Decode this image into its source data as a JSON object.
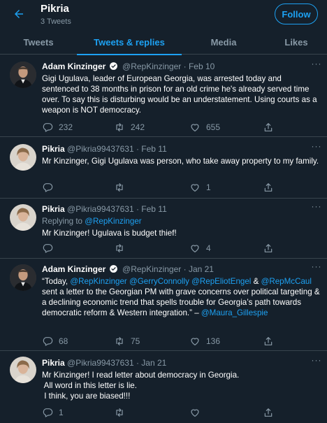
{
  "header": {
    "title": "Pikria",
    "subtitle": "3 Tweets",
    "follow_label": "Follow"
  },
  "tabs": [
    {
      "label": "Tweets",
      "active": false
    },
    {
      "label": "Tweets & replies",
      "active": true
    },
    {
      "label": "Media",
      "active": false
    },
    {
      "label": "Likes",
      "active": false
    }
  ],
  "colors": {
    "background": "#15202b",
    "accent": "#1da1f2",
    "muted": "#8899a6",
    "divider": "#38444d"
  },
  "tweets": [
    {
      "name": "Adam Kinzinger",
      "verified": true,
      "handle": "@RepKinzinger",
      "date": "· Feb 10",
      "text": "Gigi Ugulava, leader of European Georgia, was arrested today and sentenced to 38 months in prison for an old crime he's already served time over. To say this is disturbing would be an understatement. Using courts as a weapon is NOT democracy.",
      "replies": "232",
      "retweets": "242",
      "likes": "655"
    },
    {
      "name": "Pikria",
      "verified": false,
      "handle": "@Pikria99437631",
      "date": "· Feb 11",
      "text": "Mr Kinzinger, Gigi Ugulava was person, who take away property to my family.",
      "replies": "",
      "retweets": "",
      "likes": "1"
    },
    {
      "name": "Pikria",
      "verified": false,
      "handle": "@Pikria99437631",
      "date": "· Feb 11",
      "replying_label": "Replying to",
      "replying_handle": "@RepKinzinger",
      "text": "Mr Kinzinger! Ugulava is budget thief!",
      "replies": "",
      "retweets": "",
      "likes": "4"
    },
    {
      "name": "Adam Kinzinger",
      "verified": true,
      "handle": "@RepKinzinger",
      "date": "· Jan 21",
      "text_parts": {
        "open": "“Today,",
        "m1": "@RepKinzinger",
        "m2": "@GerryConnolly",
        "m3": "@RepEliotEngel",
        "amp": "&",
        "m4": "@RepMcCaul",
        "body": "sent a letter to the Georgian PM with grave concerns over political targeting & a declining economic trend that spells trouble for Georgia’s path towards democratic reform & Western integration.” –",
        "m5": "@Maura_Gillespie"
      },
      "replies": "68",
      "retweets": "75",
      "likes": "136"
    },
    {
      "name": "Pikria",
      "verified": false,
      "handle": "@Pikria99437631",
      "date": "· Jan 21",
      "text_lines": [
        "Mr Kinzinger! I read letter about democracy in Georgia.",
        " All word in this letter is lie.",
        " I think, you are biased!!!"
      ],
      "replies": "1",
      "retweets": "",
      "likes": ""
    }
  ]
}
